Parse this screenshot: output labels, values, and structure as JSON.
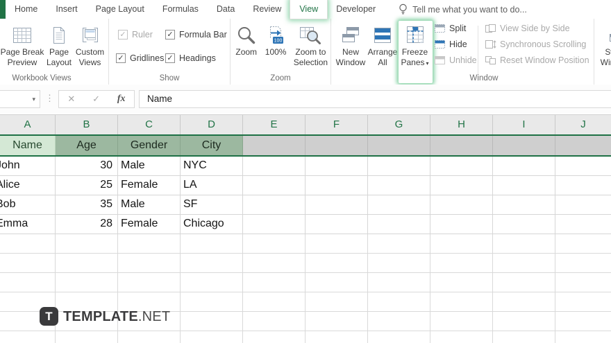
{
  "icons": {
    "dropdown": "▾",
    "check": "✓",
    "cancel": "✕",
    "enter": "✓",
    "more_dots": "⋮"
  },
  "colors": {
    "accent_green": "#217346",
    "highlight_glow": "#8fd4a8",
    "header_fill_active": "#d4e8d5",
    "header_fill_selected": "#9cb8a0",
    "selection_gray": "#cfcfcf"
  },
  "tab_bar": {
    "tabs": [
      {
        "label": "Home"
      },
      {
        "label": "Insert"
      },
      {
        "label": "Page Layout"
      },
      {
        "label": "Formulas"
      },
      {
        "label": "Data"
      },
      {
        "label": "Review"
      },
      {
        "label": "View",
        "selected": true
      },
      {
        "label": "Developer"
      }
    ],
    "tell_me": "Tell me what you want to do..."
  },
  "ribbon": {
    "workbook_views": {
      "label": "Workbook Views",
      "page_break_preview": "Page Break Preview",
      "page_layout": "Page Layout",
      "custom_views": "Custom Views"
    },
    "show": {
      "label": "Show",
      "ruler": {
        "label": "Ruler",
        "checked": true,
        "disabled": true
      },
      "gridlines": {
        "label": "Gridlines",
        "checked": true,
        "disabled": false
      },
      "formula_bar": {
        "label": "Formula Bar",
        "checked": true,
        "disabled": false
      },
      "headings": {
        "label": "Headings",
        "checked": true,
        "disabled": false
      }
    },
    "zoom": {
      "label": "Zoom",
      "zoom": "Zoom",
      "hundred": "100%",
      "zoom_to_selection": "Zoom to Selection"
    },
    "window": {
      "label": "Window",
      "new_window": "New Window",
      "arrange_all": "Arrange All",
      "freeze_panes": "Freeze Panes",
      "split": "Split",
      "hide": "Hide",
      "unhide": "Unhide",
      "view_side_by_side": "View Side by Side",
      "synchronous_scrolling": "Synchronous Scrolling",
      "reset_window_position": "Reset Window Position",
      "switch_windows": "Switch Windows"
    }
  },
  "formula_bar": {
    "formula_value": "Name",
    "fx_label": "fx"
  },
  "sheet": {
    "column_headers": [
      "A",
      "B",
      "C",
      "D",
      "E",
      "F",
      "G",
      "H",
      "I",
      "J"
    ],
    "header_row": {
      "name": "Name",
      "age": "Age",
      "gender": "Gender",
      "city": "City"
    },
    "rows": [
      {
        "name": "John",
        "age": "30",
        "gender": "Male",
        "city": "NYC"
      },
      {
        "name": "Alice",
        "age": "25",
        "gender": "Female",
        "city": "LA"
      },
      {
        "name": "Bob",
        "age": "35",
        "gender": "Male",
        "city": "SF"
      },
      {
        "name": "Emma",
        "age": "28",
        "gender": "Female",
        "city": "Chicago"
      }
    ]
  },
  "watermark": {
    "icon_letter": "T",
    "brand": "TEMPLATE",
    "suffix": ".NET"
  }
}
